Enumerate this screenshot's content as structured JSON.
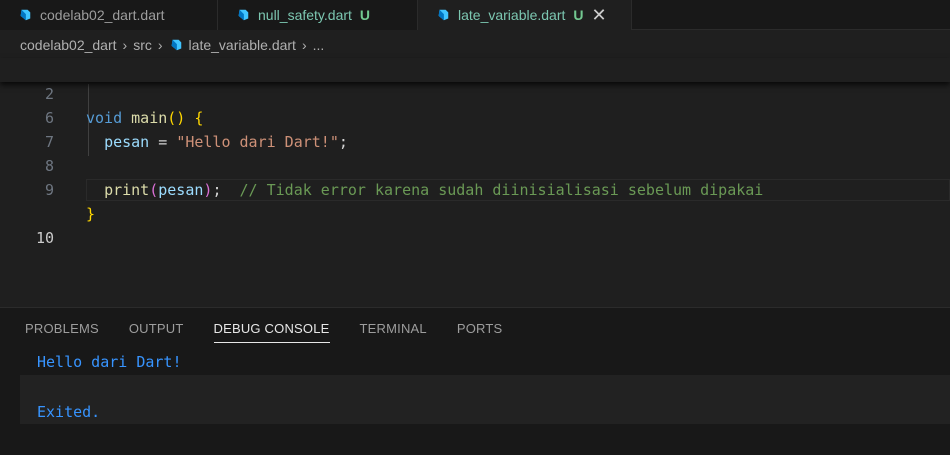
{
  "tabs": [
    {
      "label": "codelab02_dart.dart",
      "badge": "",
      "active": false
    },
    {
      "label": "null_safety.dart",
      "badge": "U",
      "active": false
    },
    {
      "label": "late_variable.dart",
      "badge": "U",
      "active": true
    }
  ],
  "tab_close_glyph": "✕",
  "breadcrumb": {
    "items": [
      "codelab02_dart",
      "src",
      "late_variable.dart",
      "..."
    ],
    "separator": "›"
  },
  "code": {
    "lines": [
      {
        "number": "2",
        "tokens": [
          "void",
          " ",
          "main",
          "()",
          " ",
          "{"
        ]
      },
      {
        "number": "6",
        "tokens": [
          "  ",
          "pesan",
          " = ",
          "\"Hello dari Dart!\"",
          ";"
        ]
      },
      {
        "number": "7",
        "tokens": []
      },
      {
        "number": "8",
        "tokens": [
          "  ",
          "print",
          "(",
          "pesan",
          ");",
          "  ",
          "// Tidak error karena sudah diinisialisasi sebelum dipakai"
        ]
      },
      {
        "number": "9",
        "tokens": [
          "}"
        ]
      },
      {
        "number": "10",
        "tokens": []
      }
    ]
  },
  "panel": {
    "tabs": [
      "PROBLEMS",
      "OUTPUT",
      "DEBUG CONSOLE",
      "TERMINAL",
      "PORTS"
    ],
    "active_tab": "DEBUG CONSOLE",
    "console_lines": [
      "Hello dari Dart!",
      "",
      "Exited."
    ]
  },
  "colors": {
    "accent_tab": "#7cc7b1",
    "untracked_badge": "#73c991",
    "console_text": "#3794ff",
    "dart_icon": "#40c4ff"
  }
}
